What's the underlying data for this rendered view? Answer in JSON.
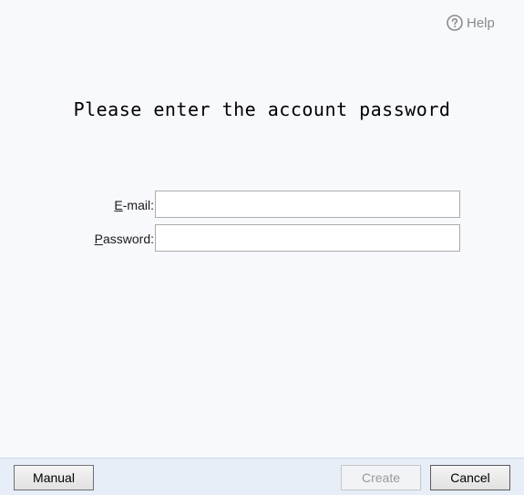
{
  "help": {
    "icon": "question-circle-icon",
    "label": "Help"
  },
  "title": "Please enter the account password",
  "form": {
    "email": {
      "label_accel": "E",
      "label_rest": "-mail:",
      "value": "",
      "placeholder": ""
    },
    "password": {
      "label_accel": "P",
      "label_rest": "assword:",
      "value": "",
      "placeholder": ""
    }
  },
  "footer": {
    "manual_label": "Manual",
    "create_label": "Create",
    "cancel_label": "Cancel"
  },
  "colors": {
    "background": "#f8f9fd",
    "footer_background": "#e7eef8",
    "disabled_text": "#9a9a9a",
    "help_text": "#8a8a8a"
  }
}
